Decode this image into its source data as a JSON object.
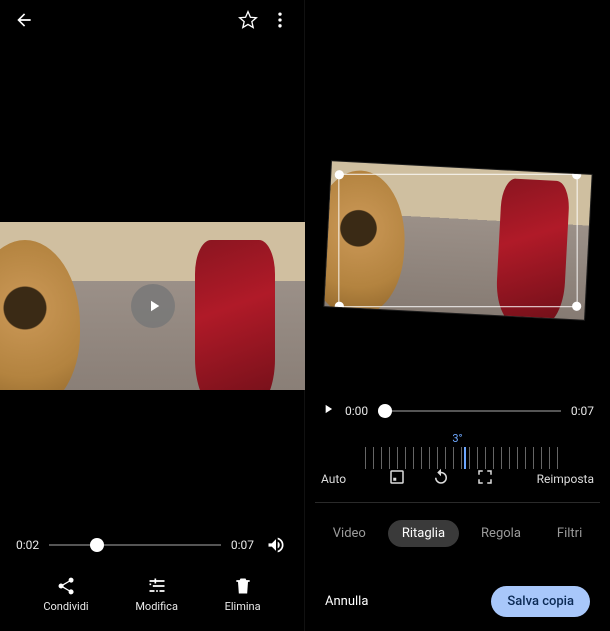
{
  "left": {
    "scrubber": {
      "current": "0:02",
      "duration": "0:07"
    },
    "actions": {
      "share": "Condividi",
      "edit": "Modifica",
      "delete": "Elimina"
    }
  },
  "right": {
    "scrubber": {
      "current": "0:00",
      "duration": "0:07"
    },
    "angle": "3°",
    "tools": {
      "auto": "Auto",
      "reset": "Reimposta"
    },
    "tabs": {
      "video": "Video",
      "crop": "Ritaglia",
      "adjust": "Regola",
      "filters": "Filtri"
    },
    "bottom": {
      "cancel": "Annulla",
      "save": "Salva copia"
    }
  }
}
